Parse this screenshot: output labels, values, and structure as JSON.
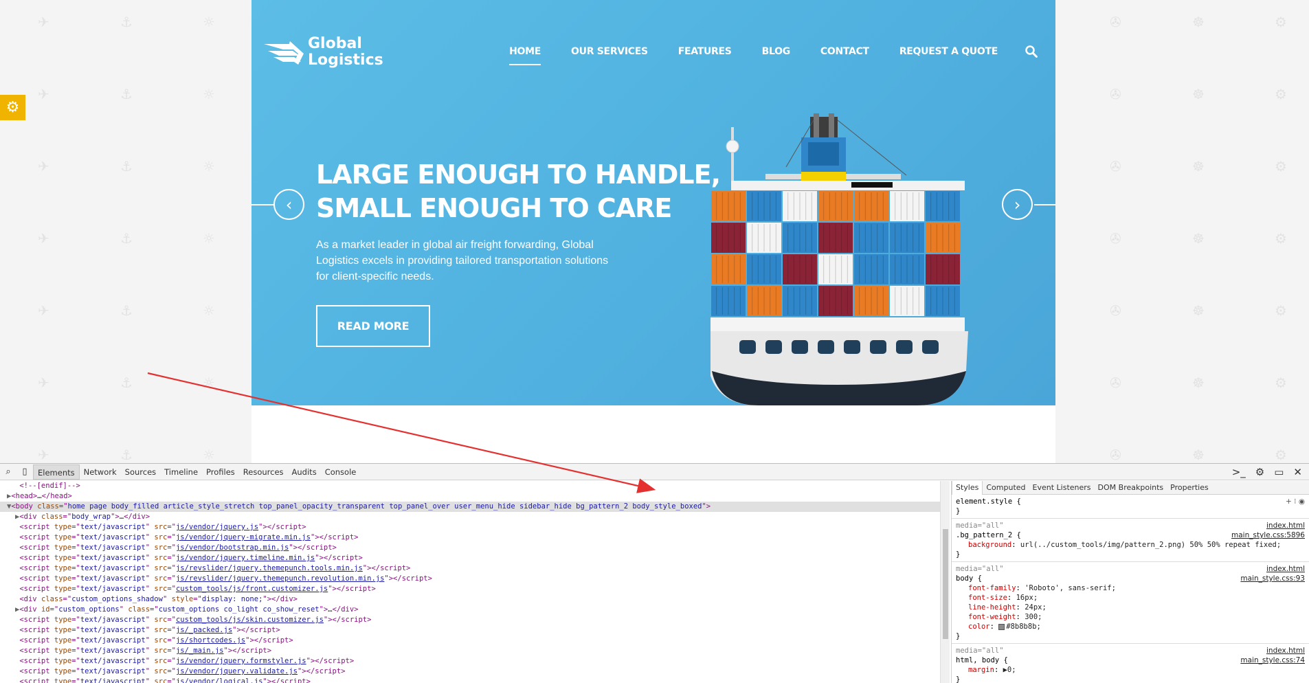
{
  "site": {
    "logo_line1": "Global",
    "logo_line2": "Logistics",
    "nav": [
      "HOME",
      "OUR SERVICES",
      "FEATURES",
      "BLOG",
      "CONTACT",
      "REQUEST A QUOTE"
    ],
    "hero_title_line1": "LARGE ENOUGH TO HANDLE,",
    "hero_title_line2": "SMALL ENOUGH TO CARE",
    "hero_text": "As a market leader in global air freight forwarding, Global Logistics excels in providing tailored transportation solutions for client-specific needs.",
    "read_more": "READ MORE",
    "colors": {
      "hero": "#52b3e1",
      "accent_tab": "#f0b400",
      "annotation_arrow": "#e53030"
    }
  },
  "devtools": {
    "tabs": [
      "Elements",
      "Network",
      "Sources",
      "Timeline",
      "Profiles",
      "Resources",
      "Audits",
      "Console"
    ],
    "active_tab": "Elements",
    "dom_lines": [
      {
        "indent": 1,
        "html": "<span class='tag'>&lt;!--[endif]--&gt;</span>"
      },
      {
        "indent": 0,
        "caret": "▶",
        "html": "<span class='tag'>&lt;head&gt;</span><span class='txt'>…</span><span class='tag'>&lt;/head&gt;</span>"
      },
      {
        "indent": 0,
        "caret": "▼",
        "sel": true,
        "html": "<span class='tag'>&lt;body </span><span class='attr-n'>class</span><span class='tag'>=\"</span><span class='attr-v'>home page body_filled article_style_stretch top_panel_opacity_transparent top_panel_over user_menu_hide sidebar_hide bg_pattern_2 body_style_boxed</span><span class='tag'>\"&gt;</span>"
      },
      {
        "indent": 1,
        "caret": "▶",
        "html": "<span class='tag'>&lt;div </span><span class='attr-n'>class</span><span class='tag'>=\"</span><span class='attr-v'>body_wrap</span><span class='tag'>\"&gt;</span><span class='txt'>…</span><span class='tag'>&lt;/div&gt;</span>"
      },
      {
        "indent": 1,
        "src": "js/vendor/jquery.js"
      },
      {
        "indent": 1,
        "src": "js/vendor/jquery-migrate.min.js"
      },
      {
        "indent": 1,
        "src": "js/vendor/bootstrap.min.js"
      },
      {
        "indent": 1,
        "src": "js/vendor/jquery.timeline.min.js"
      },
      {
        "indent": 1,
        "src": "js/revslider/jquery.themepunch.tools.min.js"
      },
      {
        "indent": 1,
        "src": "js/revslider/jquery.themepunch.revolution.min.js"
      },
      {
        "indent": 1,
        "src": "custom_tools/js/front.customizer.js"
      },
      {
        "indent": 1,
        "html": "<span class='tag'>&lt;div </span><span class='attr-n'>class</span><span class='tag'>=\"</span><span class='attr-v'>custom_options_shadow</span><span class='tag'>\" </span><span class='attr-n'>style</span><span class='tag'>=\"</span><span class='attr-v'>display: none;</span><span class='tag'>\"&gt;&lt;/div&gt;</span>"
      },
      {
        "indent": 1,
        "caret": "▶",
        "html": "<span class='tag'>&lt;div </span><span class='attr-n'>id</span><span class='tag'>=\"</span><span class='attr-v'>custom_options</span><span class='tag'>\" </span><span class='attr-n'>class</span><span class='tag'>=\"</span><span class='attr-v'>custom_options co_light co_show_reset</span><span class='tag'>\"&gt;</span><span class='txt'>…</span><span class='tag'>&lt;/div&gt;</span>"
      },
      {
        "indent": 1,
        "src": "custom_tools/js/skin.customizer.js"
      },
      {
        "indent": 1,
        "src": "js/_packed.js"
      },
      {
        "indent": 1,
        "src": "js/shortcodes.js"
      },
      {
        "indent": 1,
        "src": "js/_main.js"
      },
      {
        "indent": 1,
        "src": "js/vendor/jquery.formstyler.js"
      },
      {
        "indent": 1,
        "src": "js/vendor/jquery.validate.js"
      },
      {
        "indent": 1,
        "src": "js/vendor/logical.js"
      }
    ],
    "styles_tabs": [
      "Styles",
      "Computed",
      "Event Listeners",
      "DOM Breakpoints",
      "Properties"
    ],
    "rules": [
      {
        "media": "",
        "selector": "element.style {",
        "src": "",
        "props": []
      },
      {
        "media": "media=\"all\"",
        "media_src": "index.html",
        "selector": ".bg_pattern_2 {",
        "src": "main_style.css:5896",
        "props": [
          {
            "n": "background",
            "v": "url(../custom_tools/img/pattern_2.png) 50% 50% repeat fixed;"
          }
        ]
      },
      {
        "media": "media=\"all\"",
        "media_src": "index.html",
        "selector": "body {",
        "src": "main_style.css:93",
        "props": [
          {
            "n": "font-family",
            "v": "'Roboto', sans-serif;"
          },
          {
            "n": "font-size",
            "v": "16px;"
          },
          {
            "n": "line-height",
            "v": "24px;"
          },
          {
            "n": "font-weight",
            "v": "300;"
          },
          {
            "n": "color",
            "v": "#8b8b8b;",
            "swatch": true
          }
        ]
      },
      {
        "media": "media=\"all\"",
        "media_src": "index.html",
        "selector": "html, body {",
        "src": "main_style.css:74",
        "props": [
          {
            "n": "margin",
            "v": "▶0;"
          }
        ]
      }
    ]
  }
}
